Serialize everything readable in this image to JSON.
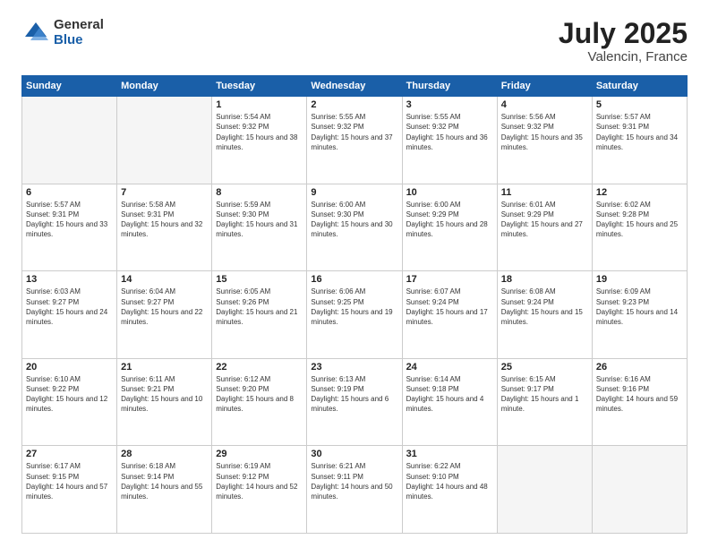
{
  "logo": {
    "general": "General",
    "blue": "Blue"
  },
  "title": "July 2025",
  "subtitle": "Valencin, France",
  "days_of_week": [
    "Sunday",
    "Monday",
    "Tuesday",
    "Wednesday",
    "Thursday",
    "Friday",
    "Saturday"
  ],
  "weeks": [
    [
      {
        "day": "",
        "empty": true
      },
      {
        "day": "",
        "empty": true
      },
      {
        "day": "1",
        "sunrise": "5:54 AM",
        "sunset": "9:32 PM",
        "daylight": "15 hours and 38 minutes."
      },
      {
        "day": "2",
        "sunrise": "5:55 AM",
        "sunset": "9:32 PM",
        "daylight": "15 hours and 37 minutes."
      },
      {
        "day": "3",
        "sunrise": "5:55 AM",
        "sunset": "9:32 PM",
        "daylight": "15 hours and 36 minutes."
      },
      {
        "day": "4",
        "sunrise": "5:56 AM",
        "sunset": "9:32 PM",
        "daylight": "15 hours and 35 minutes."
      },
      {
        "day": "5",
        "sunrise": "5:57 AM",
        "sunset": "9:31 PM",
        "daylight": "15 hours and 34 minutes."
      }
    ],
    [
      {
        "day": "6",
        "sunrise": "5:57 AM",
        "sunset": "9:31 PM",
        "daylight": "15 hours and 33 minutes."
      },
      {
        "day": "7",
        "sunrise": "5:58 AM",
        "sunset": "9:31 PM",
        "daylight": "15 hours and 32 minutes."
      },
      {
        "day": "8",
        "sunrise": "5:59 AM",
        "sunset": "9:30 PM",
        "daylight": "15 hours and 31 minutes."
      },
      {
        "day": "9",
        "sunrise": "6:00 AM",
        "sunset": "9:30 PM",
        "daylight": "15 hours and 30 minutes."
      },
      {
        "day": "10",
        "sunrise": "6:00 AM",
        "sunset": "9:29 PM",
        "daylight": "15 hours and 28 minutes."
      },
      {
        "day": "11",
        "sunrise": "6:01 AM",
        "sunset": "9:29 PM",
        "daylight": "15 hours and 27 minutes."
      },
      {
        "day": "12",
        "sunrise": "6:02 AM",
        "sunset": "9:28 PM",
        "daylight": "15 hours and 25 minutes."
      }
    ],
    [
      {
        "day": "13",
        "sunrise": "6:03 AM",
        "sunset": "9:27 PM",
        "daylight": "15 hours and 24 minutes."
      },
      {
        "day": "14",
        "sunrise": "6:04 AM",
        "sunset": "9:27 PM",
        "daylight": "15 hours and 22 minutes."
      },
      {
        "day": "15",
        "sunrise": "6:05 AM",
        "sunset": "9:26 PM",
        "daylight": "15 hours and 21 minutes."
      },
      {
        "day": "16",
        "sunrise": "6:06 AM",
        "sunset": "9:25 PM",
        "daylight": "15 hours and 19 minutes."
      },
      {
        "day": "17",
        "sunrise": "6:07 AM",
        "sunset": "9:24 PM",
        "daylight": "15 hours and 17 minutes."
      },
      {
        "day": "18",
        "sunrise": "6:08 AM",
        "sunset": "9:24 PM",
        "daylight": "15 hours and 15 minutes."
      },
      {
        "day": "19",
        "sunrise": "6:09 AM",
        "sunset": "9:23 PM",
        "daylight": "15 hours and 14 minutes."
      }
    ],
    [
      {
        "day": "20",
        "sunrise": "6:10 AM",
        "sunset": "9:22 PM",
        "daylight": "15 hours and 12 minutes."
      },
      {
        "day": "21",
        "sunrise": "6:11 AM",
        "sunset": "9:21 PM",
        "daylight": "15 hours and 10 minutes."
      },
      {
        "day": "22",
        "sunrise": "6:12 AM",
        "sunset": "9:20 PM",
        "daylight": "15 hours and 8 minutes."
      },
      {
        "day": "23",
        "sunrise": "6:13 AM",
        "sunset": "9:19 PM",
        "daylight": "15 hours and 6 minutes."
      },
      {
        "day": "24",
        "sunrise": "6:14 AM",
        "sunset": "9:18 PM",
        "daylight": "15 hours and 4 minutes."
      },
      {
        "day": "25",
        "sunrise": "6:15 AM",
        "sunset": "9:17 PM",
        "daylight": "15 hours and 1 minute."
      },
      {
        "day": "26",
        "sunrise": "6:16 AM",
        "sunset": "9:16 PM",
        "daylight": "14 hours and 59 minutes."
      }
    ],
    [
      {
        "day": "27",
        "sunrise": "6:17 AM",
        "sunset": "9:15 PM",
        "daylight": "14 hours and 57 minutes."
      },
      {
        "day": "28",
        "sunrise": "6:18 AM",
        "sunset": "9:14 PM",
        "daylight": "14 hours and 55 minutes."
      },
      {
        "day": "29",
        "sunrise": "6:19 AM",
        "sunset": "9:12 PM",
        "daylight": "14 hours and 52 minutes."
      },
      {
        "day": "30",
        "sunrise": "6:21 AM",
        "sunset": "9:11 PM",
        "daylight": "14 hours and 50 minutes."
      },
      {
        "day": "31",
        "sunrise": "6:22 AM",
        "sunset": "9:10 PM",
        "daylight": "14 hours and 48 minutes."
      },
      {
        "day": "",
        "empty": true
      },
      {
        "day": "",
        "empty": true
      }
    ]
  ]
}
